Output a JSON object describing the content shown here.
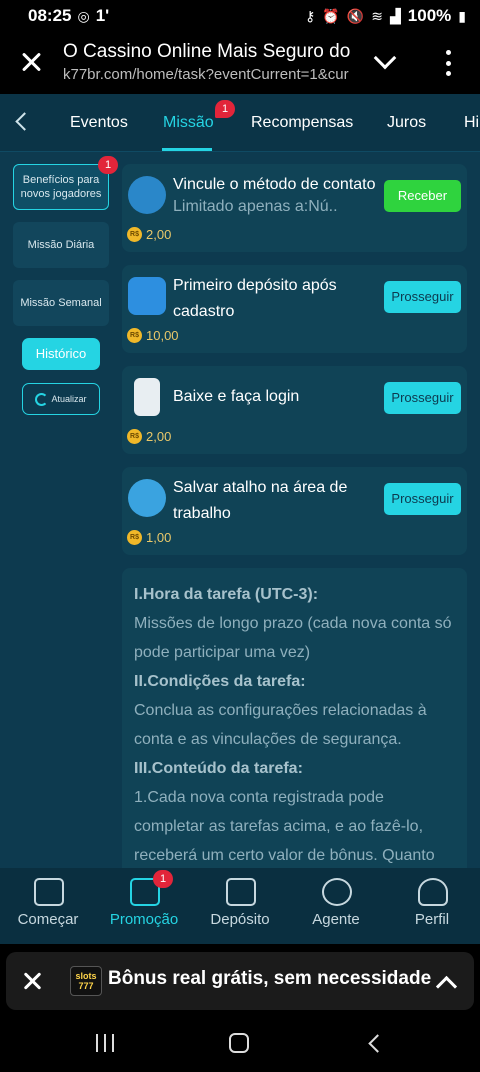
{
  "status_bar": {
    "time": "08:25",
    "temp": "1'",
    "battery": "100%",
    "icons": [
      "whatsapp-icon",
      "key-icon",
      "alarm-icon",
      "mute-icon",
      "wifi-icon",
      "signal-icon",
      "battery-icon"
    ]
  },
  "browser": {
    "title": "O Cassino Online Mais Seguro do E",
    "url": "k77br.com/home/task?eventCurrent=1&cur"
  },
  "tabs": [
    {
      "label": "Eventos"
    },
    {
      "label": "Missão",
      "badge": "1",
      "active": true
    },
    {
      "label": "Recompensas"
    },
    {
      "label": "Juros"
    },
    {
      "label": "Hi"
    }
  ],
  "sidebar": {
    "items": [
      {
        "label": "Benefícios para novos jogadores",
        "badge": "1",
        "selected": true
      },
      {
        "label": "Missão Diária"
      },
      {
        "label": "Missão Semanal"
      }
    ],
    "history_label": "Histórico",
    "refresh_label": "Atualizar"
  },
  "tasks": [
    {
      "title": "Vincule o método de contato",
      "subtitle": "Limitado apenas a:Nú...",
      "reward": "2,00",
      "currency": "R$",
      "button": "Receber",
      "icon": "contact-link-icon"
    },
    {
      "title": "Primeiro depósito após cadastro",
      "reward": "10,00",
      "currency": "R$",
      "button": "Prosseguir",
      "icon": "wallet-icon"
    },
    {
      "title": "Baixe e faça login",
      "reward": "2,00",
      "currency": "R$",
      "button": "Prosseguir",
      "icon": "download-phone-icon"
    },
    {
      "title": "Salvar atalho na área de trabalho",
      "reward": "1,00",
      "currency": "R$",
      "button": "Prosseguir",
      "icon": "globe-icon"
    }
  ],
  "info": {
    "h1": "I.Hora da tarefa (UTC-3):",
    "p1": "Missões de longo prazo (cada nova conta só pode participar uma vez)",
    "h2": "II.Condições da tarefa:",
    "p2": "Conclua as configurações relacionadas à conta e as vinculações de segurança.",
    "h3": "III.Conteúdo da tarefa:",
    "p3": "1.Cada nova conta registrada pode completar as tarefas acima, e ao fazê-lo, receberá um certo valor de bônus. Quanto"
  },
  "bottom_nav": [
    {
      "label": "Começar",
      "icon": "home-icon"
    },
    {
      "label": "Promoção",
      "icon": "gift-icon",
      "badge": "1",
      "active": true
    },
    {
      "label": "Depósito",
      "icon": "wallet-icon"
    },
    {
      "label": "Agente",
      "icon": "agent-coins-icon"
    },
    {
      "label": "Perfil",
      "icon": "profile-icon"
    }
  ],
  "banner": {
    "logo": "slots 777",
    "text": "Bônus real grátis, sem necessidade"
  },
  "colors": {
    "app_bg": "#0d3a4f",
    "card_bg": "#104356",
    "accent": "#25d4e3",
    "green_button": "#2fd33e",
    "badge_red": "#e2253a",
    "reward_gold": "#e9c86a"
  }
}
